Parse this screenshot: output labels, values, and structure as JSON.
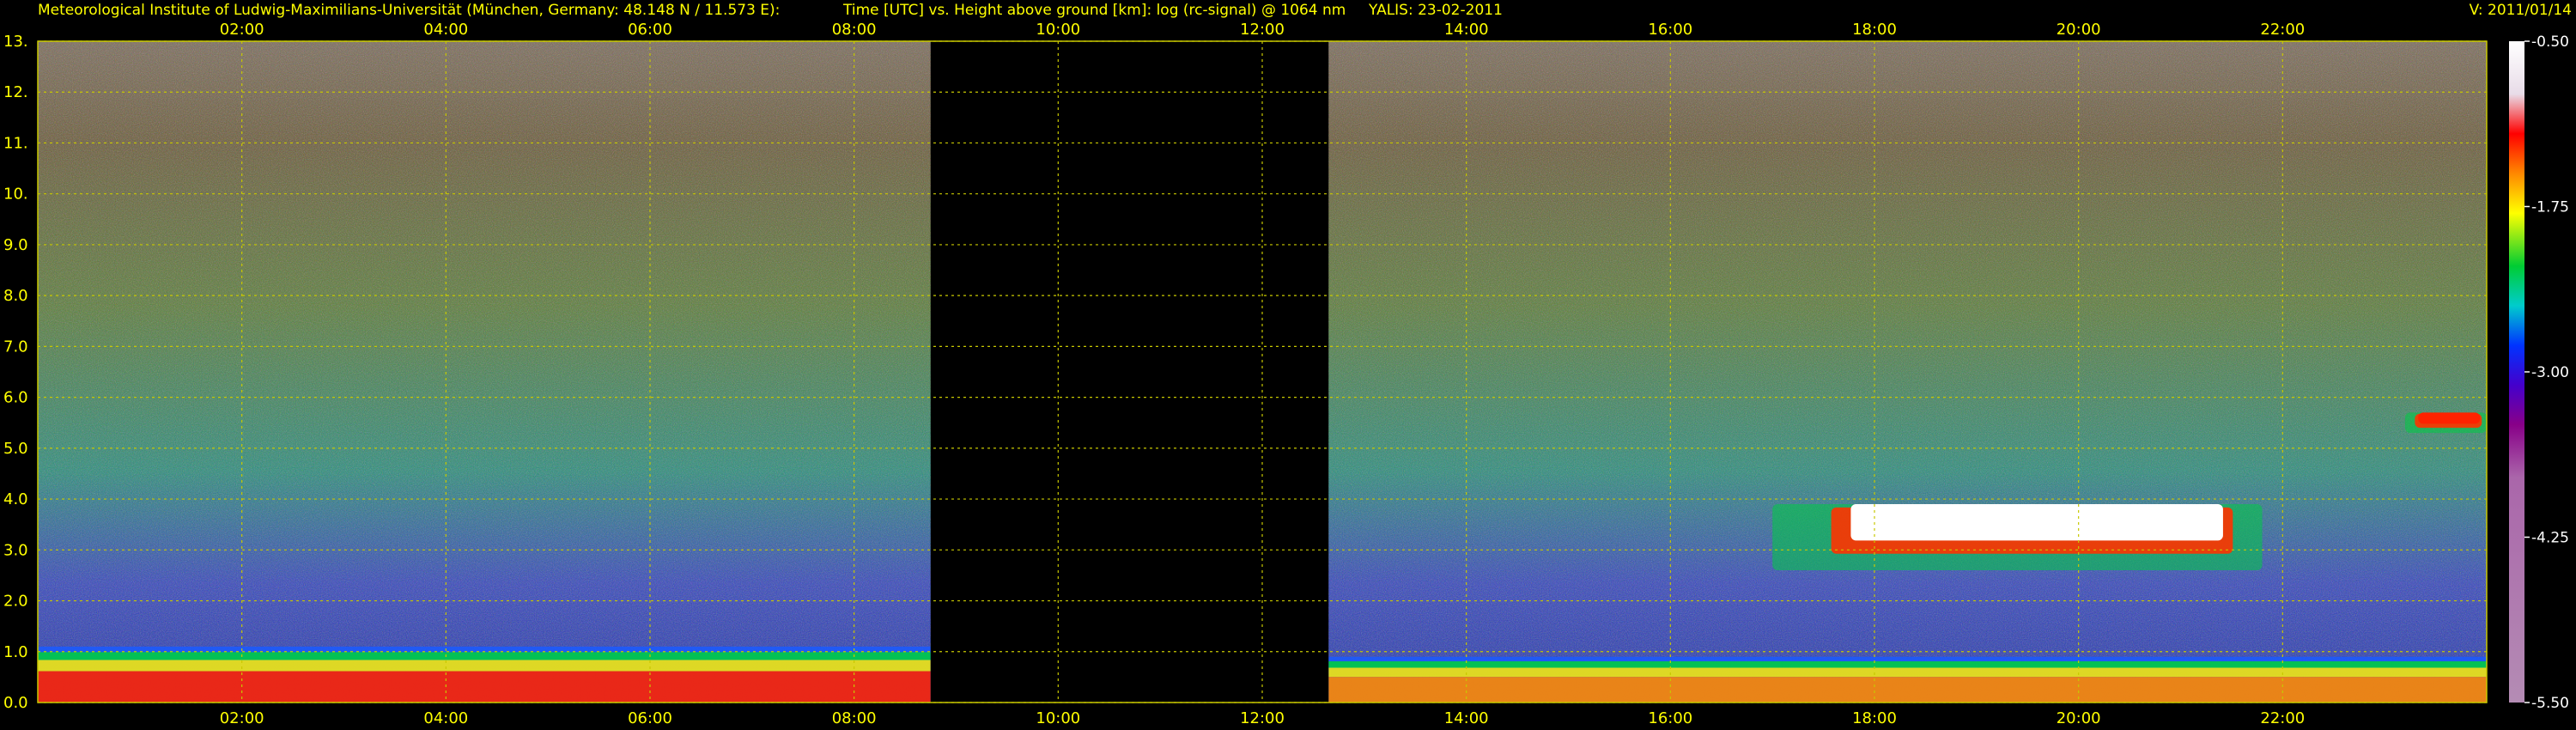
{
  "header": {
    "institute": "Meteorological Institute of Ludwig-Maximilians-Universität (München, Germany: 48.148 N / 11.573 E):",
    "description": "Time [UTC] vs. Height above ground [km]: log (rc-signal) @ 1064 nm",
    "instrument_date": "YALIS: 23-02-2011",
    "version": "V: 2011/01/14"
  },
  "colors": {
    "text": "#ffff00",
    "grid": "#c8c800",
    "background": "#000000"
  },
  "chart_data": {
    "type": "heatmap",
    "title": "",
    "xlabel": "Time [UTC]",
    "ylabel": "Height above ground [km]",
    "quantity": "log (rc-signal) @ 1064 nm",
    "xlim_hours": [
      0,
      24
    ],
    "ylim_km": [
      0,
      13
    ],
    "x_ticks": [
      "02:00",
      "04:00",
      "06:00",
      "08:00",
      "10:00",
      "12:00",
      "14:00",
      "16:00",
      "18:00",
      "20:00",
      "22:00"
    ],
    "x_tick_hours": [
      2,
      4,
      6,
      8,
      10,
      12,
      14,
      16,
      18,
      20,
      22
    ],
    "y_ticks": [
      "0.0",
      "1.0",
      "2.0",
      "3.0",
      "4.0",
      "5.0",
      "6.0",
      "7.0",
      "8.0",
      "9.0",
      "10.",
      "11.",
      "12.",
      "13."
    ],
    "y_tick_values": [
      0,
      1,
      2,
      3,
      4,
      5,
      6,
      7,
      8,
      9,
      10,
      11,
      12,
      13
    ],
    "grid": true,
    "data_gaps_hours": [
      [
        8.75,
        12.65
      ]
    ],
    "colorbar": {
      "placement": "right",
      "ticks": [
        "-0.50",
        "-1.75",
        "-3.00",
        "-4.25",
        "-5.50"
      ],
      "tick_values": [
        -0.5,
        -1.75,
        -3.0,
        -4.25,
        -5.5
      ],
      "range": [
        -5.5,
        -0.5
      ]
    },
    "features": [
      {
        "kind": "boundary-layer",
        "t": [
          0.0,
          8.75
        ],
        "z_km": [
          0.0,
          1.1
        ],
        "level": -1.5
      },
      {
        "kind": "boundary-layer",
        "t": [
          12.65,
          24.0
        ],
        "z_km": [
          0.0,
          0.9
        ],
        "level": -2.0
      },
      {
        "kind": "cloud-layer",
        "t": [
          17.0,
          21.8
        ],
        "z_km": [
          2.6,
          3.9
        ],
        "level": -0.8
      },
      {
        "kind": "cloud-layer",
        "t": [
          23.2,
          24.0
        ],
        "z_km": [
          5.3,
          5.7
        ],
        "level": -1.0
      }
    ]
  }
}
